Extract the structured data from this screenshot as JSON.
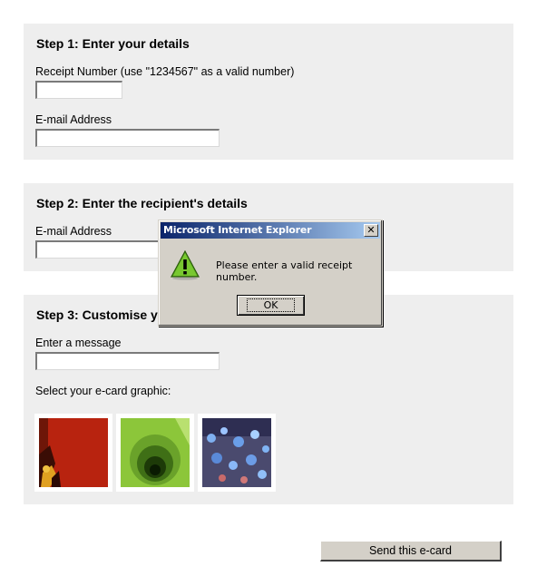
{
  "step1": {
    "title": "Step 1: Enter your details",
    "receipt_label": "Receipt Number (use \"1234567\" as a valid number)",
    "receipt_value": "",
    "email_label": "E-mail Address",
    "email_value": ""
  },
  "step2": {
    "title": "Step 2: Enter the recipient's details",
    "email_label": "E-mail Address",
    "email_value": ""
  },
  "step3": {
    "title": "Step 3: Customise y",
    "message_label": "Enter a message",
    "message_value": "",
    "graphic_label": "Select your e-card graphic:",
    "graphics": [
      "red-flower-card",
      "green-circles-card",
      "blue-lights-card"
    ]
  },
  "send_button_label": "Send this e-card",
  "dialog": {
    "title": "Microsoft Internet Explorer",
    "close_glyph": "✕",
    "icon": "warning-icon",
    "message": "Please enter a valid receipt number.",
    "ok_label": "OK"
  },
  "colors": {
    "panel_bg": "#eeeeee",
    "dialog_bg": "#d4d0c8",
    "titlebar_start": "#0a246a",
    "titlebar_end": "#a6caf0",
    "warning_green": "#5fb01f"
  }
}
